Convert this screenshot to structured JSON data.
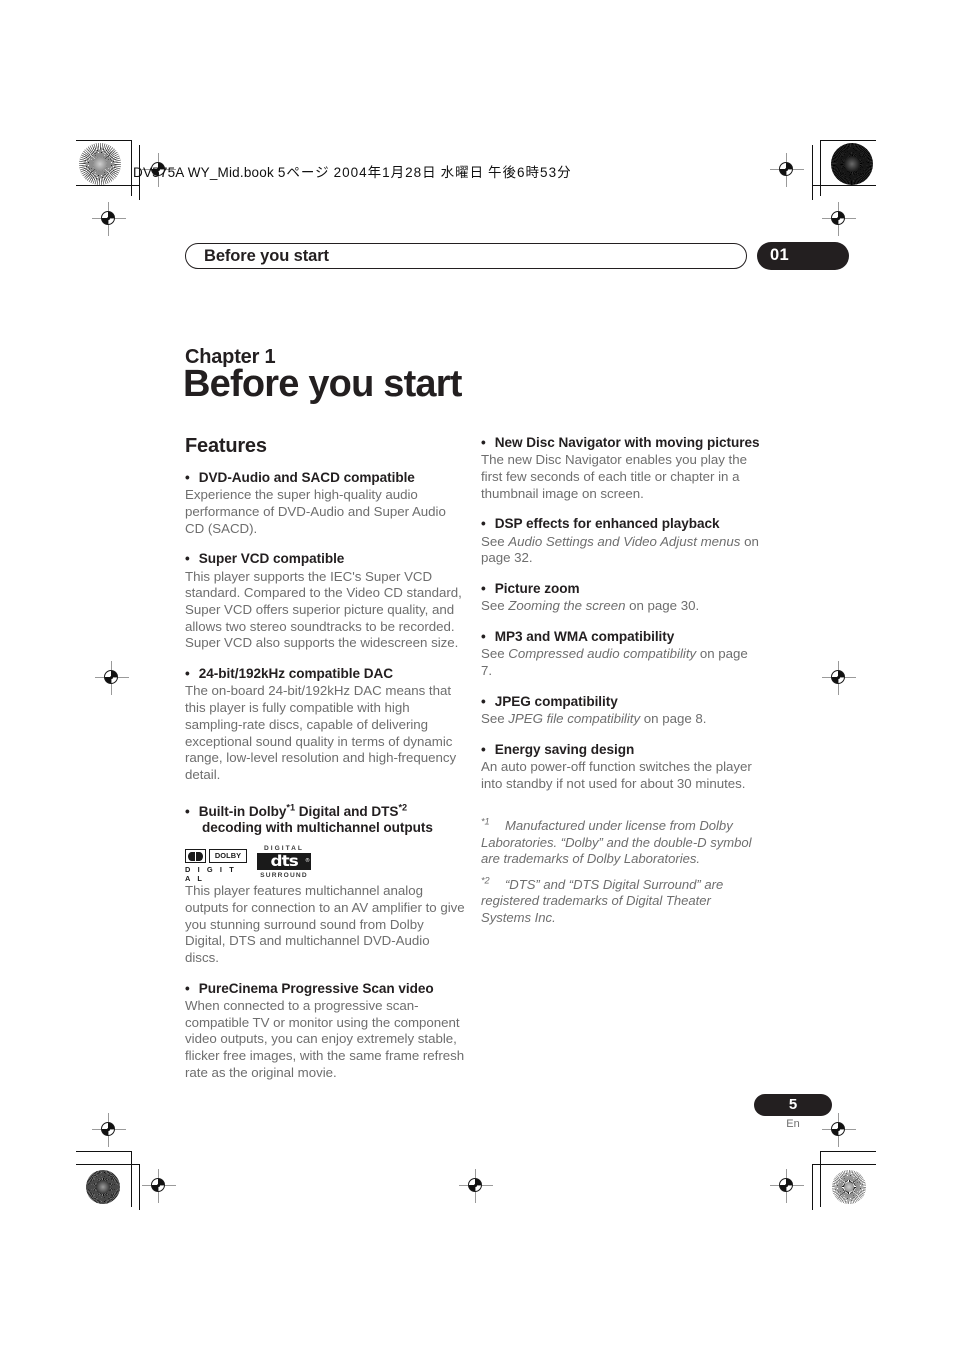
{
  "printer_slug": {
    "filename": "DV575A WY_Mid.book",
    "page_marker": "5ページ",
    "date": "2004年1月28日",
    "weekday": "水曜日",
    "time": "午後6時53分",
    "full": "DV575A WY_Mid.book  5ページ  ２００４年１月２８日　水曜日　午後６時５３分"
  },
  "running_head": {
    "title": "Before you start",
    "chapter_number": "01"
  },
  "chapter": {
    "label": "Chapter 1",
    "title": "Before you start"
  },
  "left_column": {
    "section_title": "Features",
    "features": [
      {
        "heading": "DVD-Audio and SACD compatible",
        "body": "Experience the super high-quality audio performance of DVD-Audio and Super Audio CD (SACD)."
      },
      {
        "heading": "Super VCD compatible",
        "body": "This player supports the IEC's Super VCD standard. Compared to the Video CD standard, Super VCD offers superior picture quality, and allows two stereo soundtracks to be recorded. Super VCD also supports the widescreen size."
      },
      {
        "heading": "24-bit/192kHz compatible DAC",
        "body": "The on-board 24-bit/192kHz DAC means that this player is fully compatible with high sampling-rate discs, capable of delivering exceptional sound quality in terms of dynamic range, low-level resolution and high-frequency detail."
      },
      {
        "heading_part1": "Built-in Dolby",
        "heading_sup1": "*1",
        "heading_part2": " Digital and DTS",
        "heading_sup2": "*2",
        "heading_part3": " decoding with multichannel outputs",
        "logos": {
          "dolby": {
            "word": "DOLBY",
            "sub": "D I G I T A L",
            "symbol": "double-D"
          },
          "dts": {
            "top": "DIGITAL",
            "mark": "dts",
            "trademark": "®",
            "bottom": "SURROUND"
          }
        },
        "body": "This player features multichannel analog outputs for connection to an AV amplifier to give you stunning surround sound from Dolby Digital, DTS and multichannel DVD-Audio discs."
      },
      {
        "heading": "PureCinema Progressive Scan video",
        "body": "When connected to a progressive scan-compatible TV or monitor using the component video outputs, you can enjoy extremely stable, flicker free images, with the same frame refresh rate as the original movie."
      }
    ]
  },
  "right_column": {
    "features": [
      {
        "heading": "New Disc Navigator with moving pictures",
        "body": "The new Disc Navigator enables you play the first few seconds of each title or chapter in a thumbnail image on screen."
      },
      {
        "heading": "DSP effects for enhanced playback",
        "body_pre": "See ",
        "body_italic": "Audio Settings and Video Adjust menus",
        "body_post": " on page 32."
      },
      {
        "heading": "Picture zoom",
        "body_pre": "See ",
        "body_italic": "Zooming the screen",
        "body_post": " on page 30."
      },
      {
        "heading": "MP3 and WMA compatibility",
        "body_pre": "See ",
        "body_italic": "Compressed audio compatibility",
        "body_post": " on page 7."
      },
      {
        "heading": "JPEG compatibility",
        "body_pre": "See ",
        "body_italic": "JPEG file compatibility",
        "body_post": " on page 8."
      },
      {
        "heading": "Energy saving design",
        "body": "An auto power-off function switches the player into standby if not used for about 30 minutes."
      }
    ],
    "footnotes": [
      {
        "marker": "*1",
        "text": "Manufactured under license from Dolby Laboratories. “Dolby” and the double-D symbol are trademarks of Dolby Laboratories."
      },
      {
        "marker": "*2",
        "text": "“DTS” and “DTS Digital Surround” are registered trademarks of Digital Theater Systems Inc."
      }
    ]
  },
  "footer": {
    "page_number": "5",
    "language_code": "En"
  },
  "colors": {
    "ink": "#231f20",
    "body_text": "#6e6e6e",
    "mark_gray": "#9a9a9a",
    "paper": "#ffffff"
  }
}
